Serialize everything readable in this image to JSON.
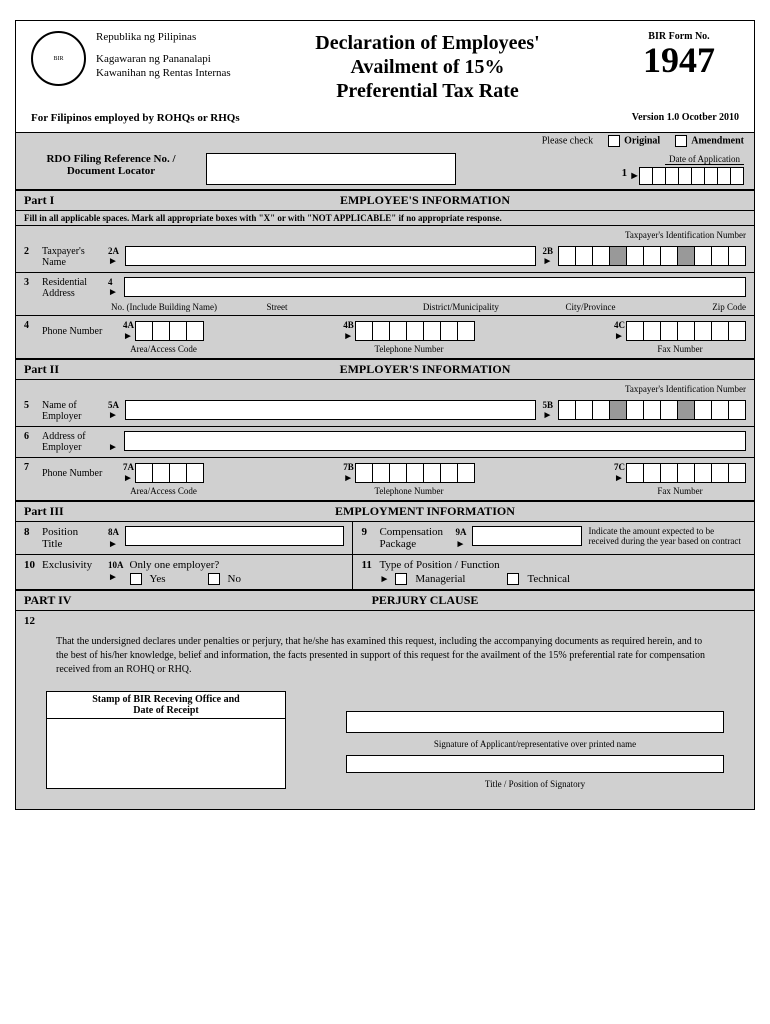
{
  "gov": {
    "country": "Republika ng Pilipinas",
    "dept": "Kagawaran ng Pananalapi",
    "bureau": "Kawanihan ng Rentas Internas"
  },
  "title_l1": "Declaration of Employees'",
  "title_l2": "Availment of 15%",
  "title_l3": "Preferential Tax Rate",
  "form_no_label": "BIR Form No.",
  "form_no": "1947",
  "subtitle": "For Filipinos employed by ROHQs or RHQs",
  "version": "Version 1.0 Ocotber 2010",
  "please_check": "Please check",
  "original": "Original",
  "amendment": "Amendment",
  "rdo_label_l1": "RDO Filing Reference No. /",
  "rdo_label_l2": "Document Locator",
  "date_application": "Date of  Application",
  "one": "1",
  "part1": {
    "label": "Part I",
    "title": "EMPLOYEE'S INFORMATION"
  },
  "instruction": "Fill in all applicable spaces.  Mark all appropriate boxes with \"X\" or with \"NOT APPLICABLE\" if no appropriate response.",
  "f2": {
    "num": "2",
    "label": "Taxpayer's Name",
    "a": "2A",
    "b": "2B",
    "tin_label": "Taxpayer's Identification Number"
  },
  "f3": {
    "num": "3",
    "label": "Residential Address",
    "sub": "4",
    "cols": {
      "c1": "No. (Include Building Name)",
      "c2": "Street",
      "c3": "District/Municipality",
      "c4": "City/Province",
      "c5": "Zip Code"
    }
  },
  "f4": {
    "num": "4",
    "label": "Phone Number",
    "a": "4A",
    "b": "4B",
    "c": "4C",
    "sa": "Area/Access Code",
    "sb": "Telephone Number",
    "sc": "Fax Number"
  },
  "part2": {
    "label": "Part II",
    "title": "EMPLOYER'S INFORMATION"
  },
  "f5": {
    "num": "5",
    "label": "Name of Employer",
    "a": "5A",
    "b": "5B",
    "tin_label": "Taxpayer's Identification Number"
  },
  "f6": {
    "num": "6",
    "label": "Address of Employer"
  },
  "f7": {
    "num": "7",
    "label": "Phone Number",
    "a": "7A",
    "b": "7B",
    "c": "7C",
    "sa": "Area/Access Code",
    "sb": "Telephone Number",
    "sc": "Fax Number"
  },
  "part3": {
    "label": "Part III",
    "title": "EMPLOYMENT INFORMATION"
  },
  "f8": {
    "num": "8",
    "label": "Position Title",
    "a": "8A"
  },
  "f9": {
    "num": "9",
    "label": "Compensation Package",
    "a": "9A",
    "note": "Indicate the amount expected to be received during the year based on contract"
  },
  "f10": {
    "num": "10",
    "label": "Exclusivity",
    "a": "10A",
    "q": "Only one employer?",
    "yes": "Yes",
    "no": "No"
  },
  "f11": {
    "num": "11",
    "label": "Type of Position / Function",
    "opt1": "Managerial",
    "opt2": "Technical"
  },
  "part4": {
    "label": "PART IV",
    "title": "PERJURY CLAUSE"
  },
  "f12_num": "12",
  "perjury": "That the undersigned declares under penalties or perjury, that he/she has examined this request, including the accompanying documents as required herein, and to the best of his/her knowledge, belief and information, the facts presented in support of this request for the availment of the 15% preferential rate for compensation received from an ROHQ or RHQ.",
  "stamp_l1": "Stamp of BIR Receving Office and",
  "stamp_l2": "Date of Receipt",
  "sig1": "Signature of Applicant/representative over printed name",
  "sig2": "Title / Position of Signatory"
}
